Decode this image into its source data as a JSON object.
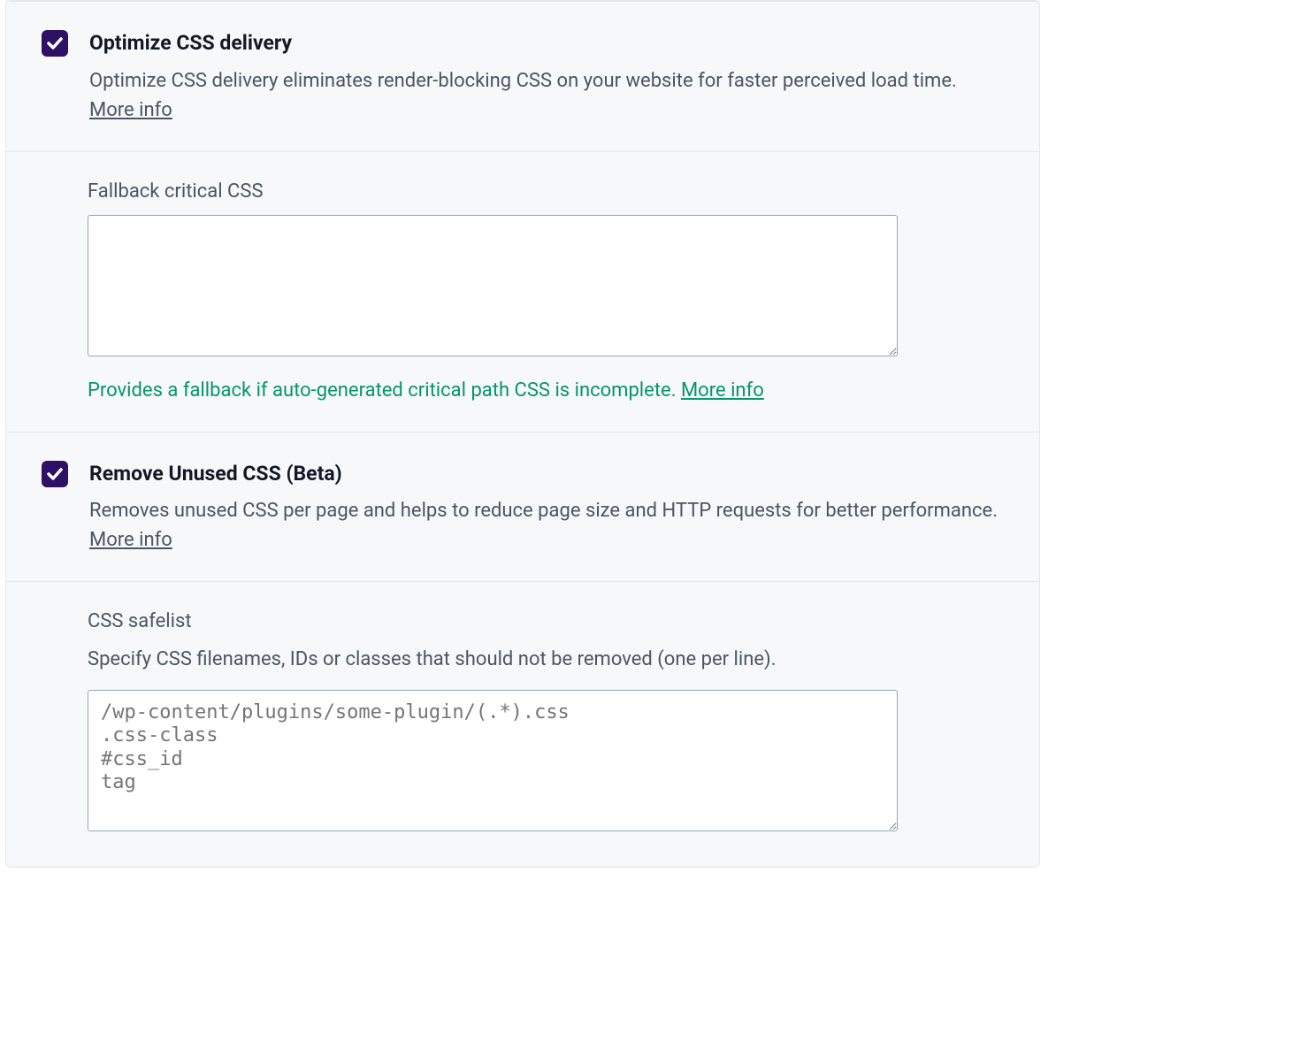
{
  "optimize": {
    "title": "Optimize CSS delivery",
    "desc": "Optimize CSS delivery eliminates render-blocking CSS on your website for faster perceived load time. ",
    "more": "More info",
    "checked": true
  },
  "fallback": {
    "title": "Fallback critical CSS",
    "value": "",
    "help": "Provides a fallback if auto-generated critical path CSS is incomplete. ",
    "more": "More info"
  },
  "remove": {
    "title": "Remove Unused CSS (Beta)",
    "desc": "Removes unused CSS per page and helps to reduce page size and HTTP requests for better performance. ",
    "more": "More info",
    "checked": true
  },
  "safelist": {
    "title": "CSS safelist",
    "help": "Specify CSS filenames, IDs or classes that should not be removed (one per line).",
    "placeholder": "/wp-content/plugins/some-plugin/(.*).css\n.css-class\n#css_id\ntag",
    "value": ""
  }
}
